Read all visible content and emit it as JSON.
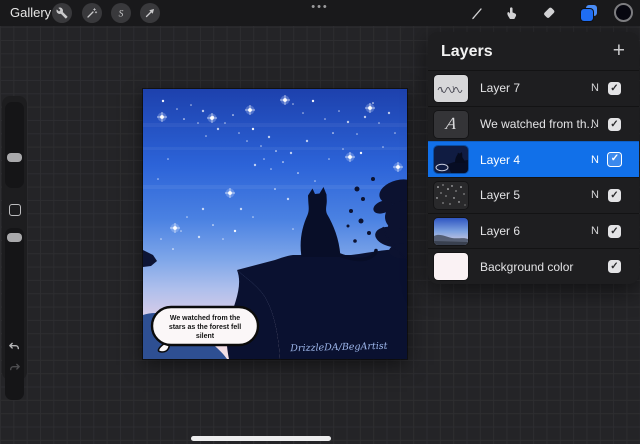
{
  "topbar": {
    "gallery_label": "Gallery",
    "more_label": "•••"
  },
  "layers_panel": {
    "title": "Layers",
    "add_glyph": "+",
    "check_glyph": "✓",
    "rows": [
      {
        "name": "Layer 7",
        "blend": "N",
        "checked": true,
        "selected": false
      },
      {
        "name": "We watched from th...",
        "blend": "N",
        "checked": true,
        "selected": false
      },
      {
        "name": "Layer 4",
        "blend": "N",
        "checked": true,
        "selected": true
      },
      {
        "name": "Layer 5",
        "blend": "N",
        "checked": true,
        "selected": false
      },
      {
        "name": "Layer 6",
        "blend": "N",
        "checked": true,
        "selected": false
      },
      {
        "name": "Background color",
        "blend": "",
        "checked": true,
        "selected": false
      }
    ]
  },
  "canvas": {
    "speech_bubble": {
      "line1": "We watched from the",
      "line2": "stars as the forest fell",
      "line3": "silent"
    },
    "signature": "DrizzleDA/BegArtist"
  },
  "colors": {
    "selected_row_blue": "#1170e9",
    "layers_icon_blue": "#1f6df2",
    "panel_bg": "#1e1e20",
    "topbar_bg": "#19191b",
    "workspace_bg": "#242427"
  }
}
